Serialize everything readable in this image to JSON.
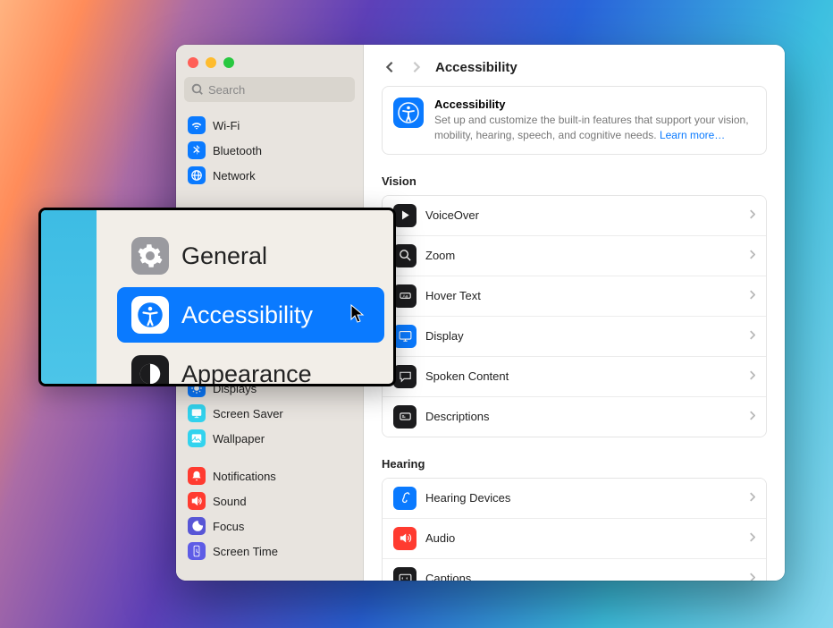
{
  "search": {
    "placeholder": "Search"
  },
  "sidebar": {
    "group1": [
      {
        "label": "Wi-Fi"
      },
      {
        "label": "Bluetooth"
      },
      {
        "label": "Network"
      }
    ],
    "group2": [
      {
        "label": "Displays"
      },
      {
        "label": "Screen Saver"
      },
      {
        "label": "Wallpaper"
      }
    ],
    "group3": [
      {
        "label": "Notifications"
      },
      {
        "label": "Sound"
      },
      {
        "label": "Focus"
      },
      {
        "label": "Screen Time"
      }
    ]
  },
  "zoom": {
    "items": [
      {
        "label": "General"
      },
      {
        "label": "Accessibility"
      },
      {
        "label": "Appearance"
      }
    ]
  },
  "header": {
    "title": "Accessibility"
  },
  "info": {
    "title": "Accessibility",
    "desc": "Set up and customize the built-in features that support your vision, mobility, hearing, speech, and cognitive needs.  ",
    "link": "Learn more…"
  },
  "sections": {
    "vision": {
      "title": "Vision",
      "items": [
        {
          "label": "VoiceOver"
        },
        {
          "label": "Zoom"
        },
        {
          "label": "Hover Text"
        },
        {
          "label": "Display"
        },
        {
          "label": "Spoken Content"
        },
        {
          "label": "Descriptions"
        }
      ]
    },
    "hearing": {
      "title": "Hearing",
      "items": [
        {
          "label": "Hearing Devices"
        },
        {
          "label": "Audio"
        },
        {
          "label": "Captions"
        }
      ]
    }
  }
}
